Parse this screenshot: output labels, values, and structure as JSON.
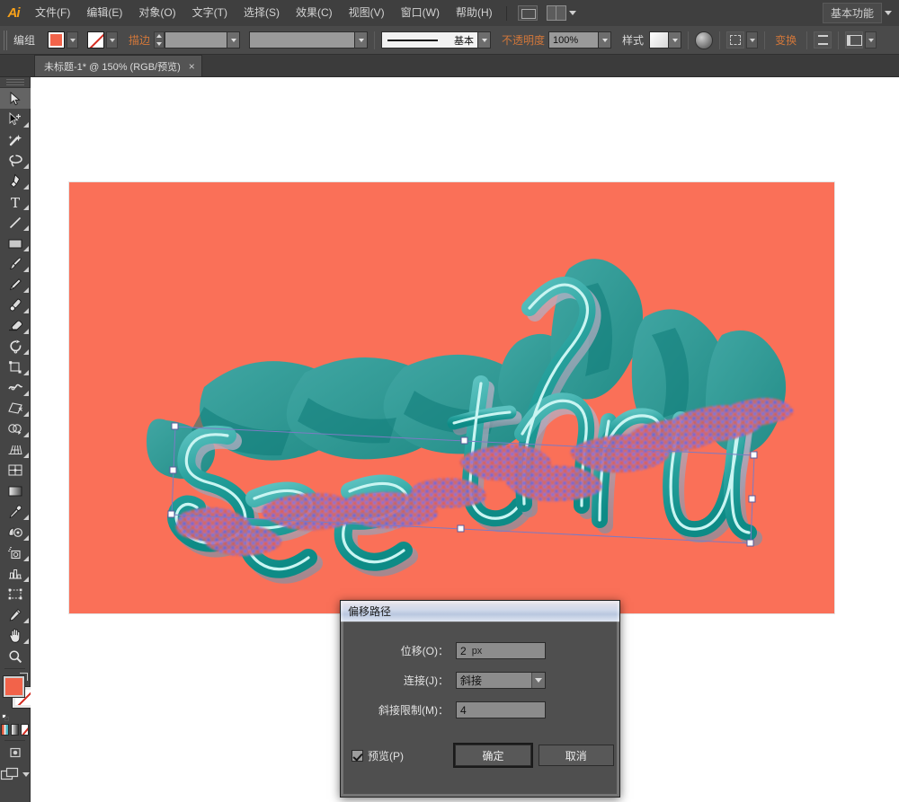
{
  "app": {
    "name": "Ai",
    "logo_color": "#f7a11a"
  },
  "menubar": {
    "items": [
      {
        "label": "文件(F)"
      },
      {
        "label": "编辑(E)"
      },
      {
        "label": "对象(O)"
      },
      {
        "label": "文字(T)"
      },
      {
        "label": "选择(S)"
      },
      {
        "label": "效果(C)"
      },
      {
        "label": "视图(V)"
      },
      {
        "label": "窗口(W)"
      },
      {
        "label": "帮助(H)"
      }
    ],
    "bridge_icon": "bridge-icon",
    "arrange_icon": "arrange-documents-icon",
    "workspace": "基本功能"
  },
  "controlbar": {
    "selection_label": "编组",
    "fill_color": "#f2634a",
    "stroke_label": "描边",
    "stroke_weight": "",
    "stroke_profile": "基本",
    "opacity_label": "不透明度",
    "opacity_value": "100%",
    "style_label": "样式",
    "transform_label": "变换",
    "align_icon": "align-icon",
    "recolor_icon": "recolor-artwork-icon",
    "select_similar_icon": "select-similar-icon",
    "panel_options_icon": "panel-options-icon"
  },
  "tabbar": {
    "document_title": "未标题-1* @ 150% (RGB/预览)",
    "close_glyph": "×"
  },
  "toolbar": {
    "tools": [
      {
        "name": "selection-tool",
        "label": "选择工具",
        "active": true
      },
      {
        "name": "direct-selection-tool",
        "label": "直接选择工具"
      },
      {
        "name": "magic-wand-tool",
        "label": "魔棒工具"
      },
      {
        "name": "lasso-tool",
        "label": "套索工具"
      },
      {
        "name": "pen-tool",
        "label": "钢笔工具"
      },
      {
        "name": "type-tool",
        "label": "文字工具"
      },
      {
        "name": "line-segment-tool",
        "label": "直线段工具"
      },
      {
        "name": "rectangle-tool",
        "label": "矩形工具"
      },
      {
        "name": "paintbrush-tool",
        "label": "画笔工具"
      },
      {
        "name": "pencil-tool",
        "label": "铅笔工具"
      },
      {
        "name": "blob-brush-tool",
        "label": "斑点画笔工具"
      },
      {
        "name": "eraser-tool",
        "label": "橡皮擦工具"
      },
      {
        "name": "rotate-tool",
        "label": "旋转工具"
      },
      {
        "name": "scale-tool",
        "label": "比例缩放工具"
      },
      {
        "name": "width-tool",
        "label": "宽度工具"
      },
      {
        "name": "free-transform-tool",
        "label": "自由变换工具"
      },
      {
        "name": "shape-builder-tool",
        "label": "形状生成器工具"
      },
      {
        "name": "perspective-grid-tool",
        "label": "透视网格工具"
      },
      {
        "name": "mesh-tool",
        "label": "网格工具"
      },
      {
        "name": "gradient-tool",
        "label": "渐变工具"
      },
      {
        "name": "eyedropper-tool",
        "label": "吸管工具"
      },
      {
        "name": "blend-tool",
        "label": "混合工具"
      },
      {
        "name": "symbol-sprayer-tool",
        "label": "符号喷枪工具"
      },
      {
        "name": "column-graph-tool",
        "label": "柱形图工具"
      },
      {
        "name": "artboard-tool",
        "label": "画板工具"
      },
      {
        "name": "slice-tool",
        "label": "切片工具"
      },
      {
        "name": "hand-tool",
        "label": "抓手工具"
      },
      {
        "name": "zoom-tool",
        "label": "缩放工具"
      }
    ],
    "fill_color": "#f2634a",
    "stroke_color": "none",
    "color_modes": [
      "color",
      "gradient",
      "none"
    ],
    "draw_mode_icon": "draw-normal-icon",
    "screen_mode_icon": "screen-mode-icon"
  },
  "canvas": {
    "artboard_bg": "#fa7058",
    "artwork_text": "see thru",
    "letter_fill_dark": "#0e8a84",
    "letter_fill_light": "#4fb8b8",
    "letter_outline": "#b8f0ee",
    "extrude_color": "#2f9a98",
    "zoom_level": "150%",
    "selection_handle_color": "#ffffff",
    "selection_stroke_color": "#6a6ab4"
  },
  "dialog": {
    "title": "偏移路径",
    "offset_label": "位移(O)：",
    "offset_value": "2",
    "offset_unit": "px",
    "join_label": "连接(J)：",
    "join_value": "斜接",
    "miter_label": "斜接限制(M)：",
    "miter_value": "4",
    "preview_label": "预览(P)",
    "preview_checked": true,
    "ok_label": "确定",
    "cancel_label": "取消"
  }
}
